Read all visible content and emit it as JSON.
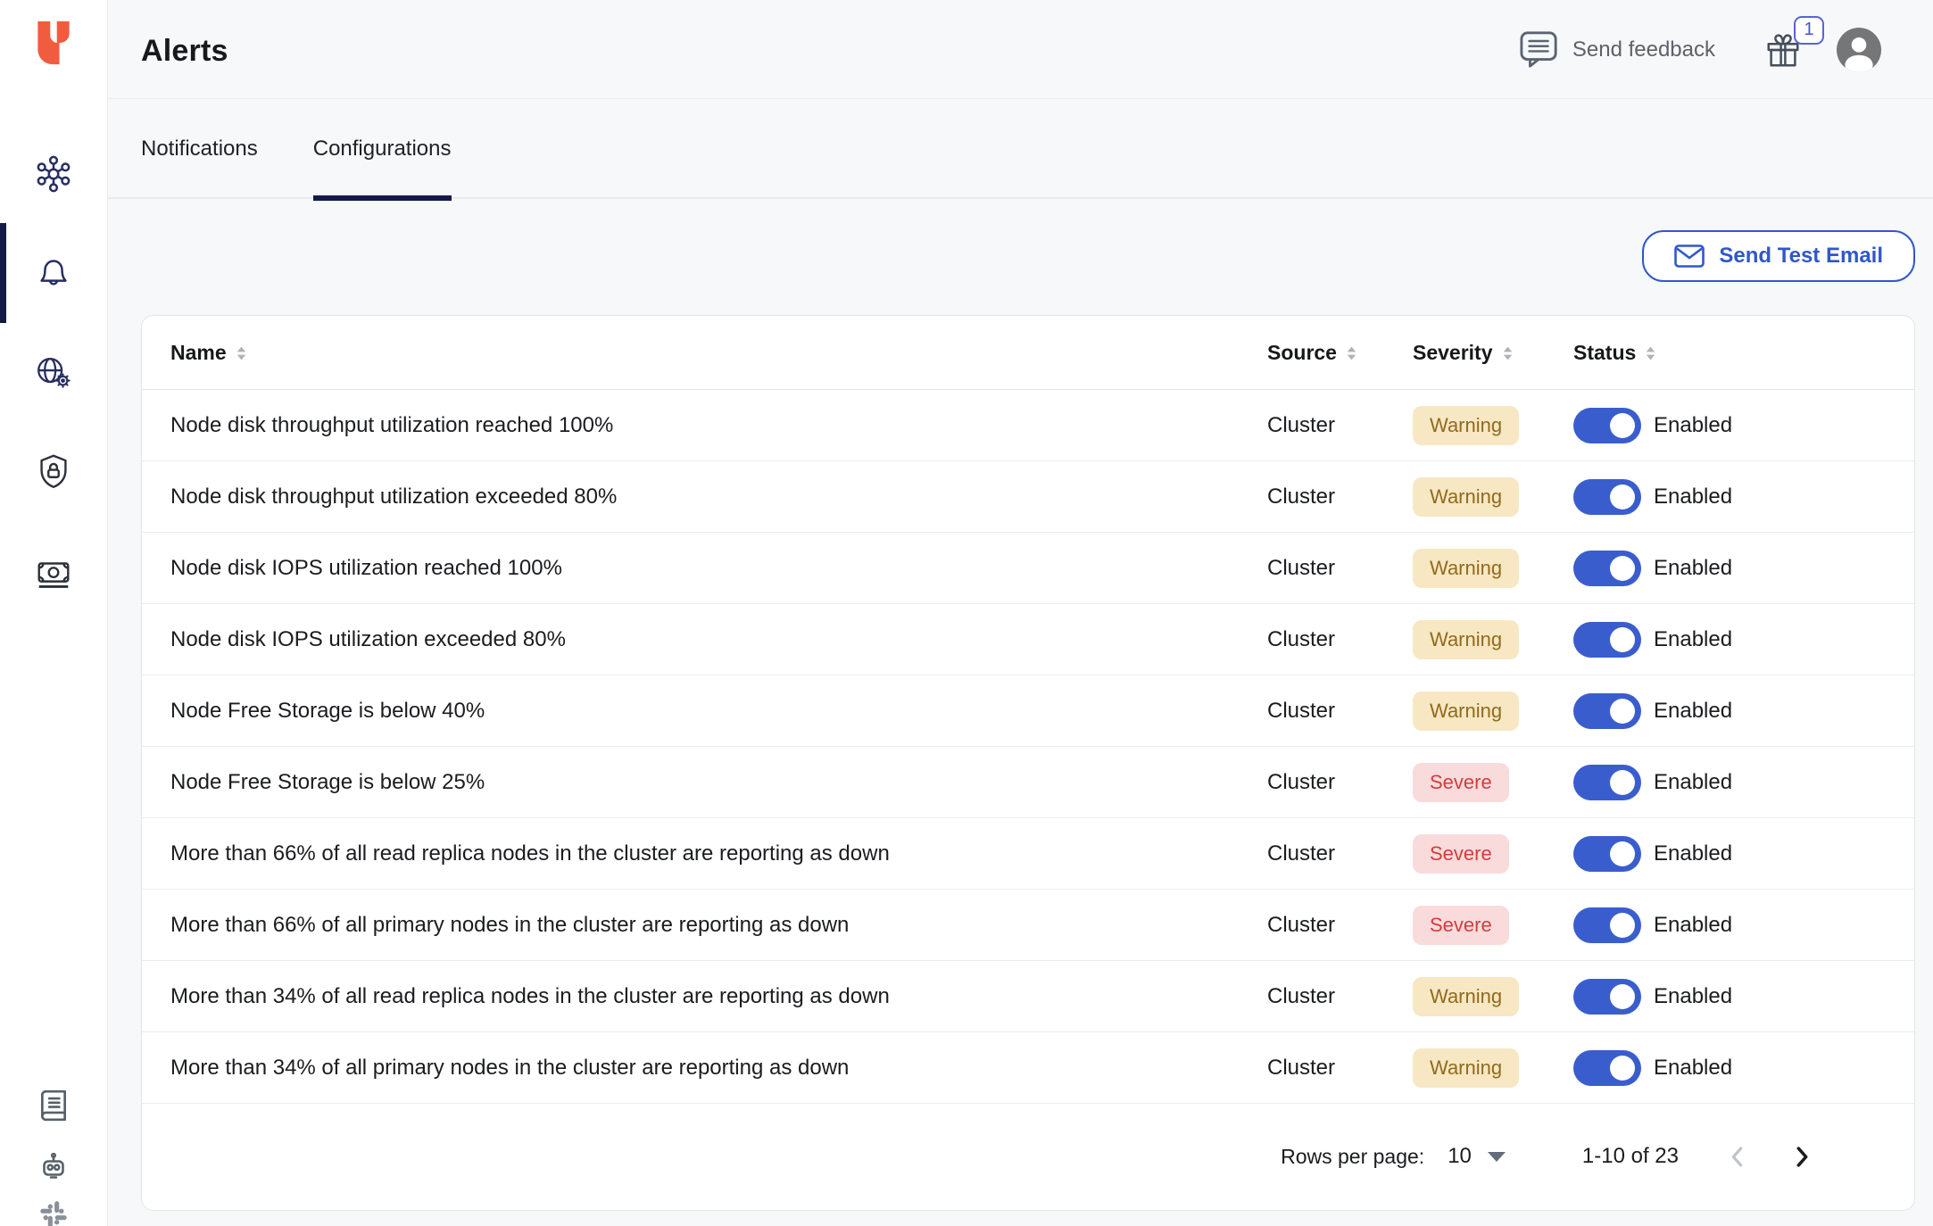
{
  "topbar": {
    "title": "Alerts",
    "send_feedback_label": "Send feedback",
    "gift_badge_count": "1"
  },
  "tabs": [
    {
      "label": "Notifications",
      "active": false
    },
    {
      "label": "Configurations",
      "active": true
    }
  ],
  "actions": {
    "send_test_email_label": "Send Test Email"
  },
  "table": {
    "columns": [
      {
        "label": "Name"
      },
      {
        "label": "Source"
      },
      {
        "label": "Severity"
      },
      {
        "label": "Status"
      }
    ],
    "rows": [
      {
        "name": "Node disk throughput utilization reached 100%",
        "source": "Cluster",
        "severity": "Warning",
        "status_label": "Enabled",
        "enabled": true
      },
      {
        "name": "Node disk throughput utilization exceeded 80%",
        "source": "Cluster",
        "severity": "Warning",
        "status_label": "Enabled",
        "enabled": true
      },
      {
        "name": "Node disk IOPS utilization reached 100%",
        "source": "Cluster",
        "severity": "Warning",
        "status_label": "Enabled",
        "enabled": true
      },
      {
        "name": "Node disk IOPS utilization exceeded 80%",
        "source": "Cluster",
        "severity": "Warning",
        "status_label": "Enabled",
        "enabled": true
      },
      {
        "name": "Node Free Storage is below 40%",
        "source": "Cluster",
        "severity": "Warning",
        "status_label": "Enabled",
        "enabled": true
      },
      {
        "name": "Node Free Storage is below 25%",
        "source": "Cluster",
        "severity": "Severe",
        "status_label": "Enabled",
        "enabled": true
      },
      {
        "name": "More than 66% of all read replica nodes in the cluster are reporting as down",
        "source": "Cluster",
        "severity": "Severe",
        "status_label": "Enabled",
        "enabled": true
      },
      {
        "name": "More than 66% of all primary nodes in the cluster are reporting as down",
        "source": "Cluster",
        "severity": "Severe",
        "status_label": "Enabled",
        "enabled": true
      },
      {
        "name": "More than 34% of all read replica nodes in the cluster are reporting as down",
        "source": "Cluster",
        "severity": "Warning",
        "status_label": "Enabled",
        "enabled": true
      },
      {
        "name": "More than 34% of all primary nodes in the cluster are reporting as down",
        "source": "Cluster",
        "severity": "Warning",
        "status_label": "Enabled",
        "enabled": true
      }
    ]
  },
  "pagination": {
    "rows_per_page_label": "Rows per page:",
    "rows_per_page_value": "10",
    "range_label": "1-10 of 23",
    "prev_enabled": false,
    "next_enabled": true
  },
  "sidebar": {
    "items": [
      {
        "icon": "cluster-network-icon",
        "active": false
      },
      {
        "icon": "bell-icon",
        "active": true
      },
      {
        "icon": "globe-gear-icon",
        "active": false
      },
      {
        "icon": "shield-lock-icon",
        "active": false
      },
      {
        "icon": "money-icon",
        "active": false
      },
      {
        "icon": "book-icon",
        "active": false
      },
      {
        "icon": "robot-icon",
        "active": false
      },
      {
        "icon": "slack-icon",
        "active": false
      }
    ]
  },
  "colors": {
    "accent_blue": "#2F58C8",
    "toggle_blue": "#3A5DCE",
    "brand_orange": "#F25C3E",
    "nav_navy": "#262E61",
    "indicator_navy": "#141A47",
    "warning_bg": "#F8E7C3",
    "warning_text": "#8F6B1E",
    "severe_bg": "#F9DBDB",
    "severe_text": "#D33C3F"
  }
}
